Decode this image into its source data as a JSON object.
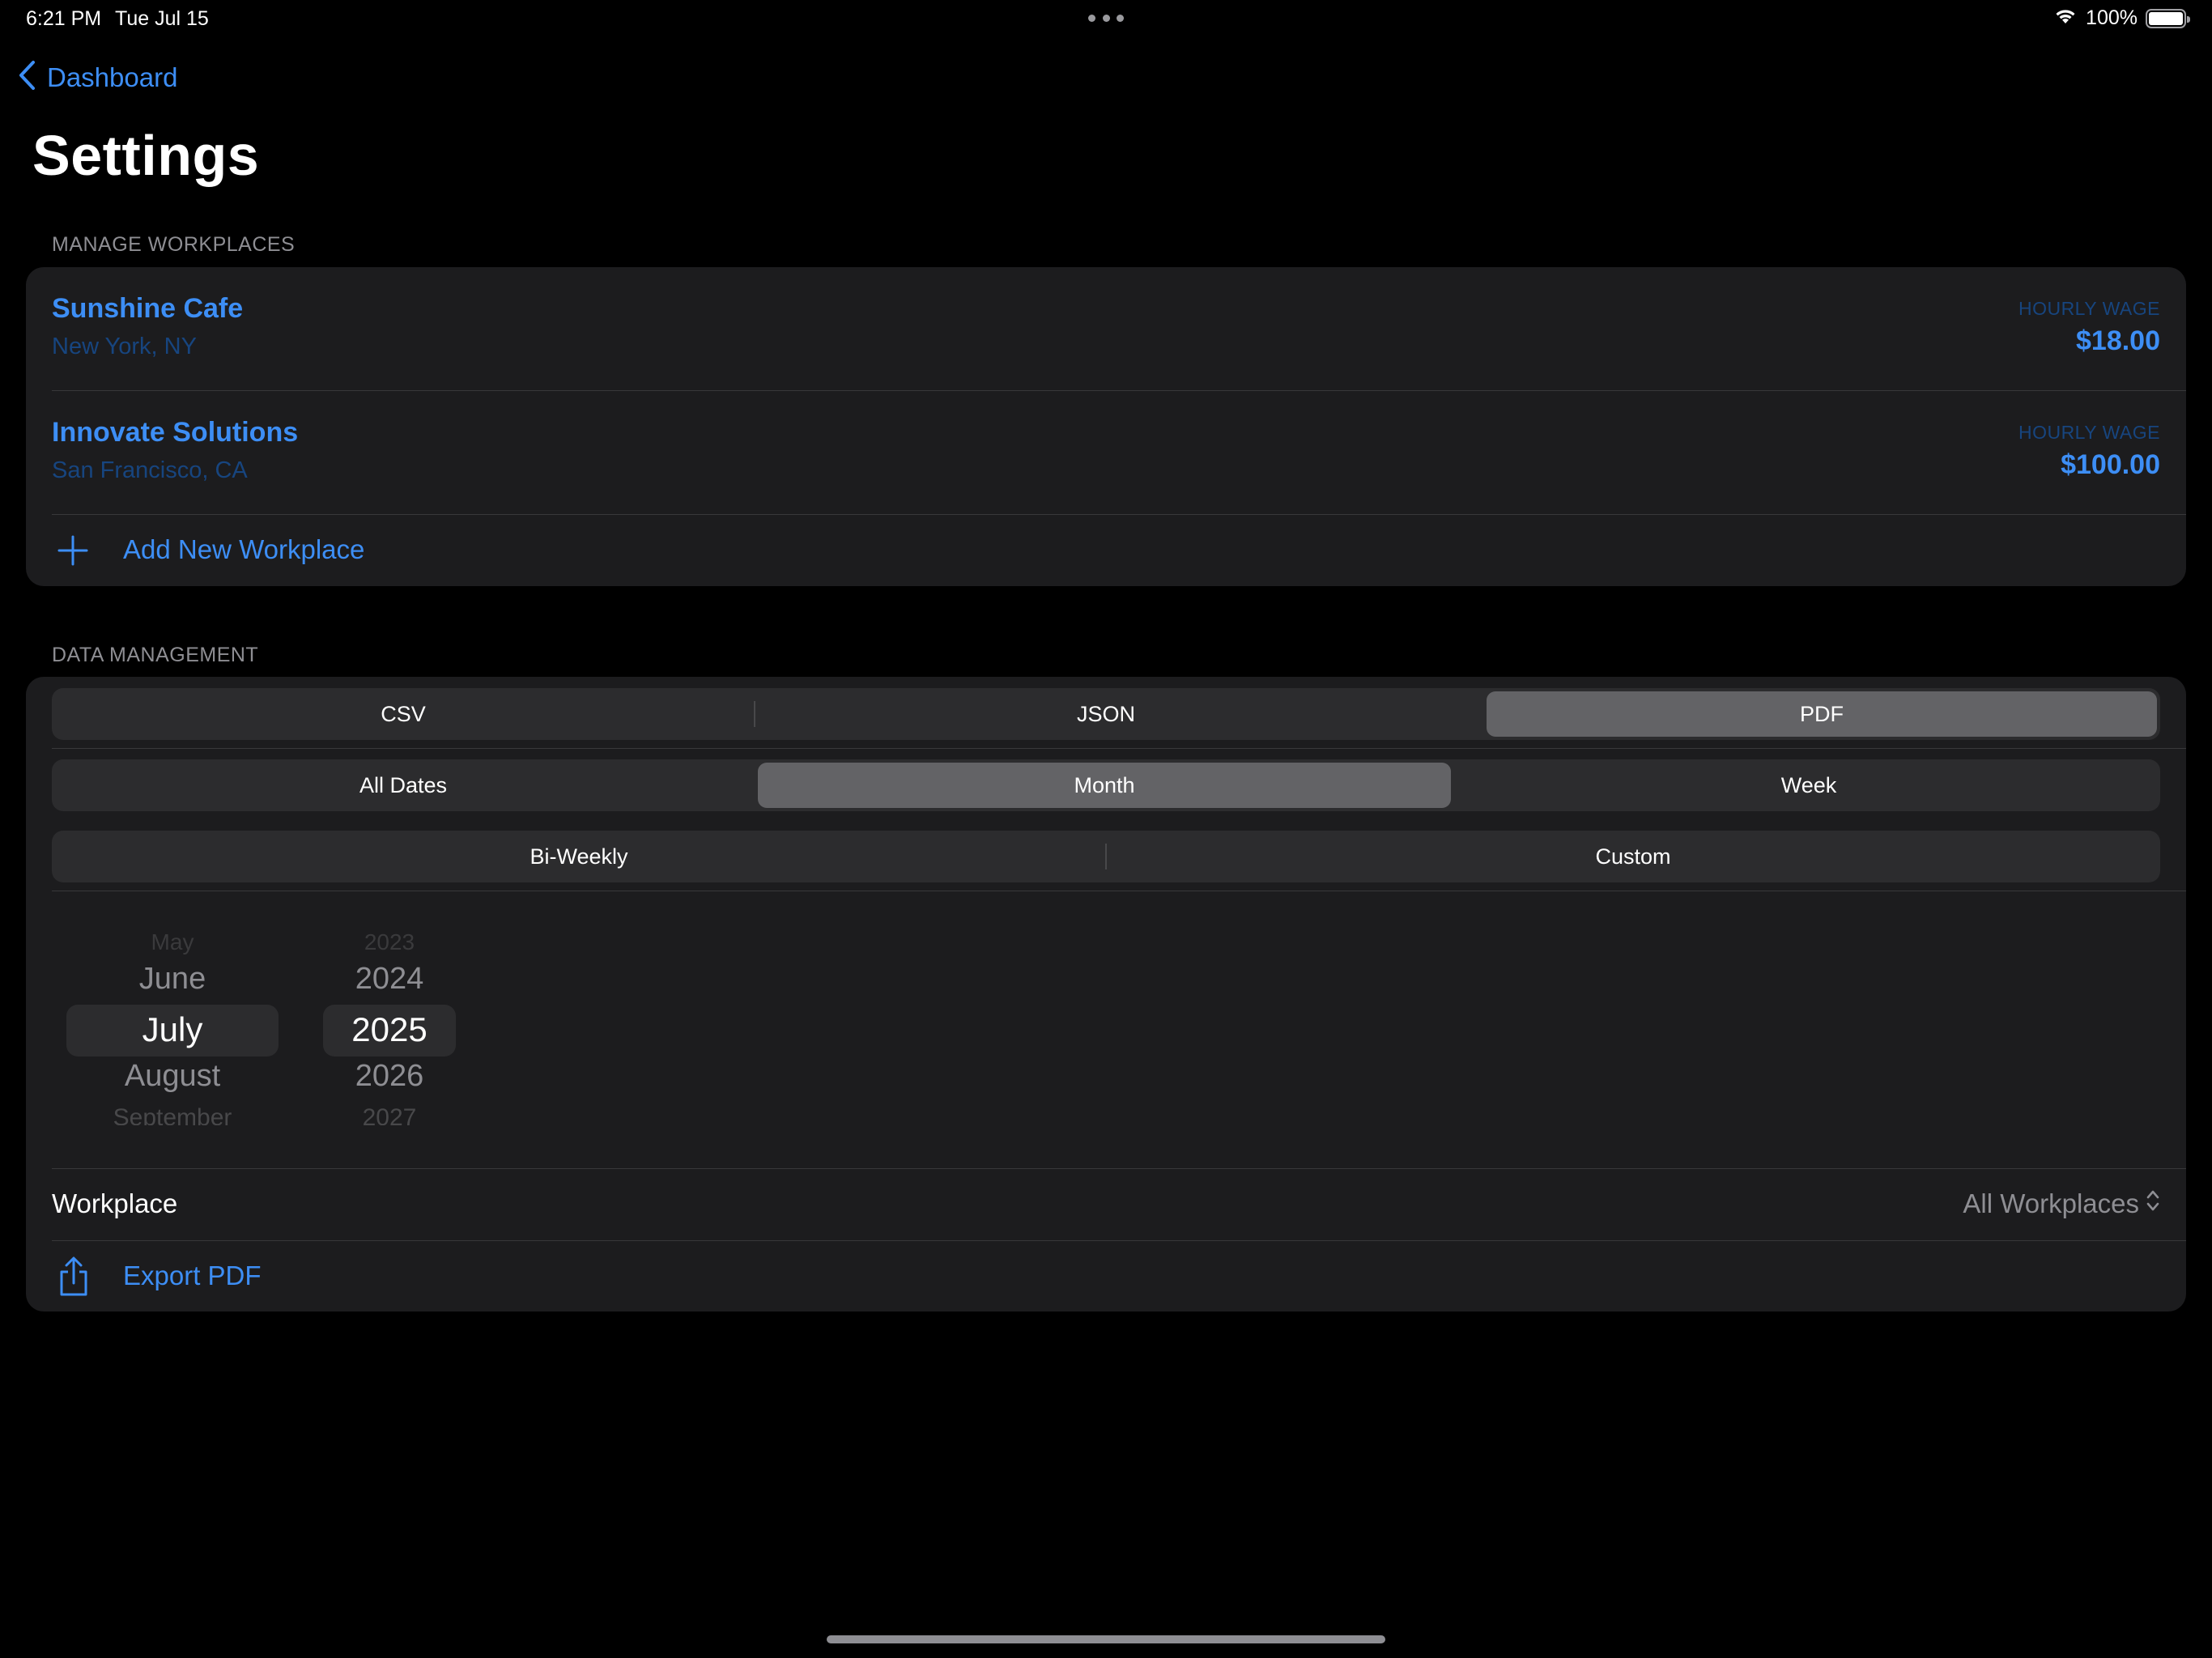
{
  "status_bar": {
    "time": "6:21 PM",
    "date": "Tue Jul 15",
    "battery_percent": "100%",
    "battery_level": 1.0,
    "icons": [
      "wifi-icon",
      "battery-icon"
    ]
  },
  "nav": {
    "back_label": "Dashboard",
    "title": "Settings"
  },
  "workplaces_section": {
    "header": "MANAGE WORKPLACES",
    "items": [
      {
        "name": "Sunshine Cafe",
        "location": "New York, NY",
        "wage_label": "HOURLY WAGE",
        "wage": "$18.00"
      },
      {
        "name": "Innovate Solutions",
        "location": "San Francisco, CA",
        "wage_label": "HOURLY WAGE",
        "wage": "$100.00"
      }
    ],
    "add_label": "Add New Workplace"
  },
  "data_section": {
    "header": "DATA MANAGEMENT",
    "format_options": [
      "CSV",
      "JSON",
      "PDF"
    ],
    "format_selected": "PDF",
    "range_options": [
      "All Dates",
      "Month",
      "Week"
    ],
    "range_selected": "Month",
    "range_options_2": [
      "Bi-Weekly",
      "Custom"
    ],
    "month_picker": {
      "items": [
        "May",
        "June",
        "July",
        "August",
        "September"
      ],
      "selected": "July"
    },
    "year_picker": {
      "items": [
        "2023",
        "2024",
        "2025",
        "2026",
        "2027"
      ],
      "selected": "2025"
    },
    "workplace_label": "Workplace",
    "workplace_value": "All Workplaces",
    "export_label": "Export PDF"
  },
  "colors": {
    "accent": "#3d8ef5",
    "background": "#000000",
    "card": "#1c1c1e",
    "segment_bg": "#2c2c2e",
    "segment_selected": "#636366",
    "secondary_text": "#8e8e93"
  }
}
